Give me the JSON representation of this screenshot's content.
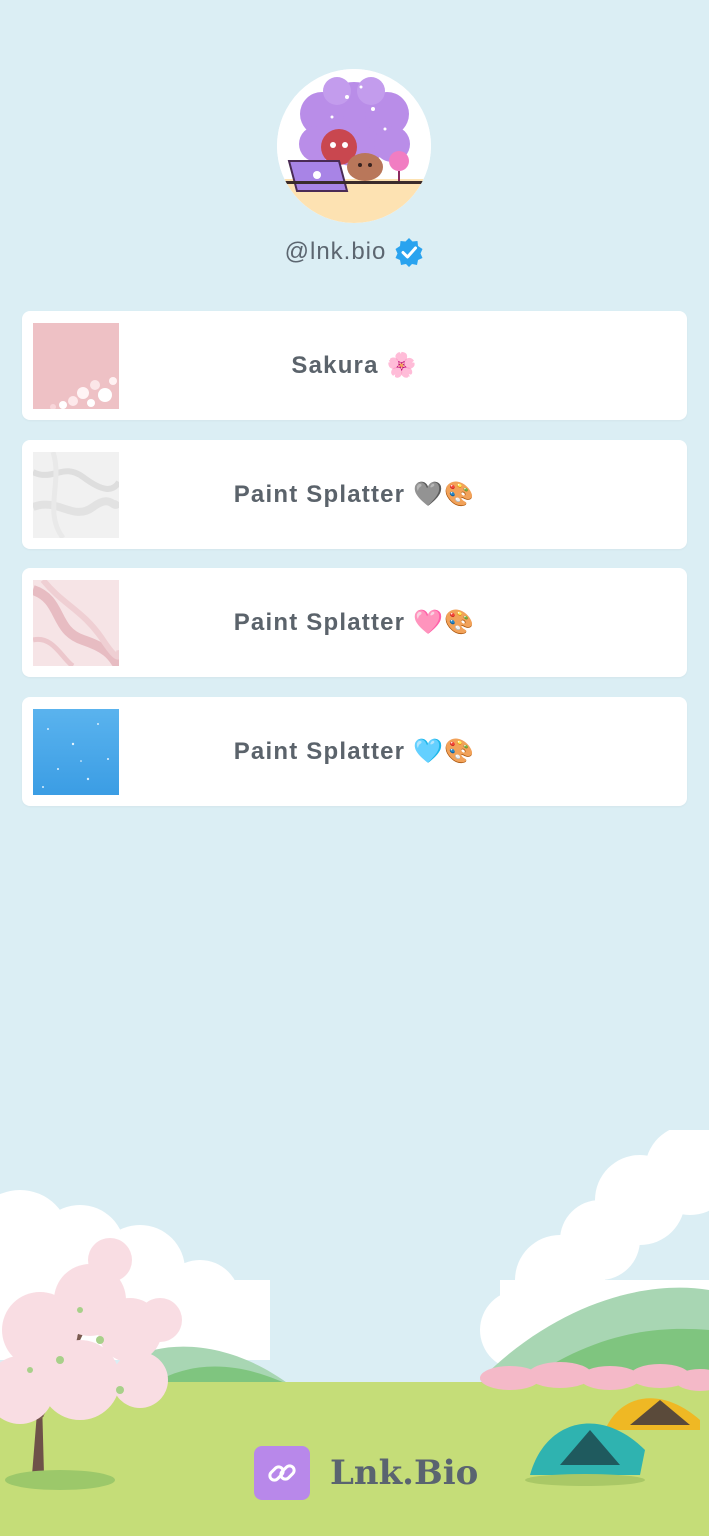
{
  "profile": {
    "handle": "@lnk.bio",
    "verified": true
  },
  "links": [
    {
      "label": "Sakura 🌸",
      "thumb": "cherry-blossom"
    },
    {
      "label": "Paint Splatter 🩶🎨",
      "thumb": "white-marble"
    },
    {
      "label": "Paint Splatter 🩷🎨",
      "thumb": "pink-marble"
    },
    {
      "label": "Paint Splatter 🩵🎨",
      "thumb": "blue-sparkle"
    }
  ],
  "footer": {
    "brand": "Lnk.Bio"
  },
  "colors": {
    "background": "#dbeef4",
    "card": "#ffffff",
    "text": "#5b636b",
    "verified": "#2aa3ef",
    "brand_accent": "#b888ea",
    "grass": "#c5dd78"
  }
}
